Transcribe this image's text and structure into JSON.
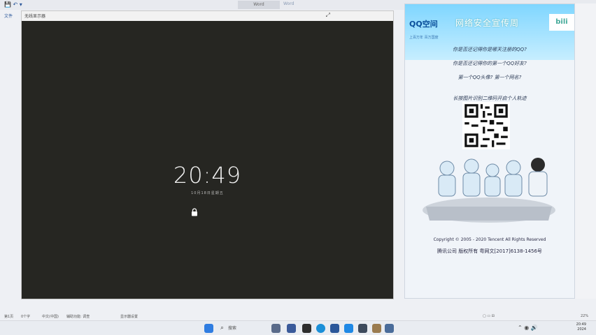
{
  "top": {
    "doc_title": "Word",
    "doc_title2": "Word",
    "ribbon_tab": "文件"
  },
  "mirror": {
    "window_title": "无线显示器",
    "lock_screen_time": "20:49",
    "lock_screen_date": "10月18日星期五"
  },
  "qq_login_ad": {
    "logo_text": "QQ空间",
    "slogan": "网络安全宣传周",
    "sub": "上百万年 百万国度",
    "lines": [
      "你是否还记得你是哪天注册的QQ?",
      "你是否还记得你的第一个QQ好友?",
      "第一个QQ头像? 第一个网名?",
      "长按图片识别二维码开启个人轨迹"
    ],
    "copyright": "Copyright © 2005 - 2020 Tencent All Rights Reserved",
    "icp": "腾讯公司 版权所有 粤网文[2017]6138-1456号",
    "colors": {
      "header_top": "#7fd6ff",
      "header_bottom": "#c7eeff",
      "text": "#2b3a55"
    }
  },
  "status_bar": {
    "page": "第1页",
    "words": "0个字",
    "lang": "中文(中国)",
    "accessibility": "辅助功能: 调查",
    "display_settings": "显示器设置",
    "zoom": "22%"
  },
  "taskbar": {
    "search_placeholder": "搜索",
    "clock_time": "20:49",
    "clock_date": "2024",
    "icons": [
      "windows-start-icon",
      "search-icon",
      "taskview-icon",
      "explorer-icon",
      "edge-icon",
      "word-icon",
      "store-icon",
      "settings-icon",
      "terminal-icon"
    ]
  }
}
